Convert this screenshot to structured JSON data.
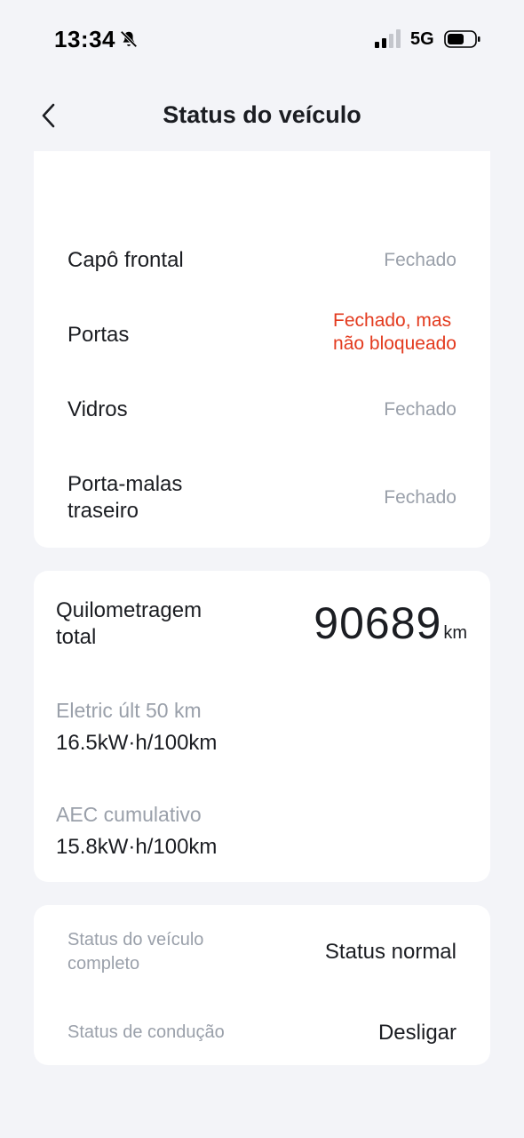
{
  "status_bar": {
    "time": "13:34",
    "network": "5G"
  },
  "header": {
    "title": "Status do veículo"
  },
  "closures": [
    {
      "label": "Capô frontal",
      "value": "Fechado",
      "status": "ok"
    },
    {
      "label": "Portas",
      "value_line1": "Fechado, mas",
      "value_line2": "não bloqueado",
      "status": "warning"
    },
    {
      "label": "Vidros",
      "value": "Fechado",
      "status": "ok"
    },
    {
      "label_line1": "Porta-malas",
      "label_line2": "traseiro",
      "value": "Fechado",
      "status": "ok"
    }
  ],
  "mileage": {
    "label_line1": "Quilometragem",
    "label_line2": "total",
    "value": "90689",
    "unit": "km"
  },
  "consumption": {
    "recent_label": "Eletric últ 50 km",
    "recent_value": "16.5kW·h/100km",
    "cumulative_label": "AEC cumulativo",
    "cumulative_value": "15.8kW·h/100km"
  },
  "vehicle_status": {
    "overall_label_line1": "Status do veículo",
    "overall_label_line2": "completo",
    "overall_value": "Status normal",
    "driving_label": "Status de condução",
    "driving_value": "Desligar"
  },
  "colors": {
    "background": "#f3f4f8",
    "card": "#ffffff",
    "text_primary": "#1b1d22",
    "text_secondary": "#9aa0aa",
    "warning": "#e33a1e"
  }
}
